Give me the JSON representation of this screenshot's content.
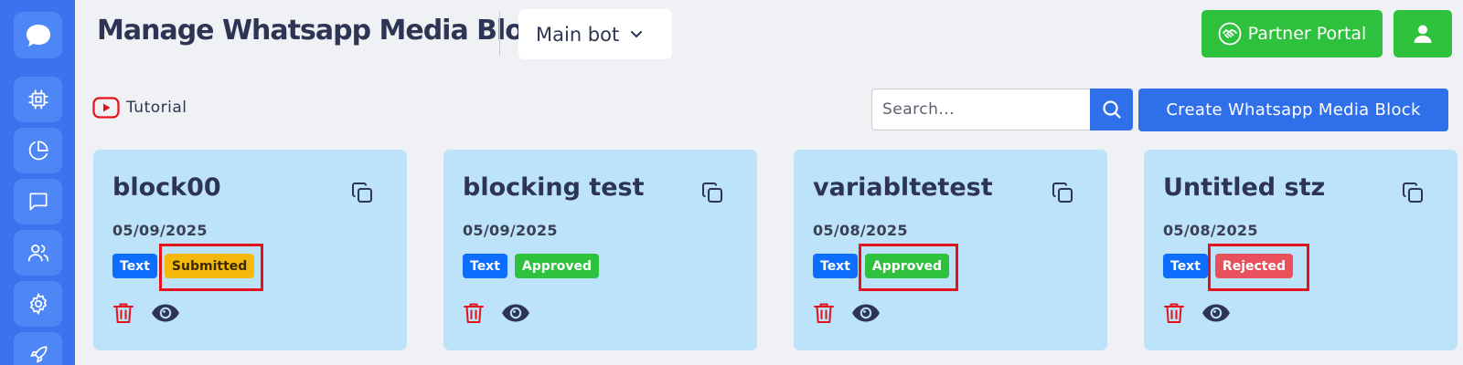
{
  "header": {
    "title": "Manage Whatsapp Media Blocks",
    "bot_select": {
      "value": "Main bot"
    },
    "partner_portal_label": "Partner Portal"
  },
  "sidebar": {
    "logo_icon": "chat-bubble-logo",
    "items": [
      {
        "icon": "chip-icon"
      },
      {
        "icon": "pie-chart-icon"
      },
      {
        "icon": "message-icon"
      },
      {
        "icon": "users-icon"
      },
      {
        "icon": "gear-icon"
      },
      {
        "icon": "rocket-icon"
      }
    ]
  },
  "toolbar": {
    "tutorial_label": "Tutorial",
    "search_placeholder": "Search...",
    "create_label": "Create Whatsapp Media Block"
  },
  "cards": [
    {
      "title": "block00",
      "date": "05/09/2025",
      "type": "Text",
      "status": "Submitted",
      "status_color": "#f5b80d",
      "status_text_color": "#3a2a00"
    },
    {
      "title": "blocking test",
      "date": "05/09/2025",
      "type": "Text",
      "status": "Approved",
      "status_color": "#2ec13e",
      "status_text_color": "#ffffff"
    },
    {
      "title": "variabltetest",
      "date": "05/08/2025",
      "type": "Text",
      "status": "Approved",
      "status_color": "#2ec13e",
      "status_text_color": "#ffffff"
    },
    {
      "title": "Untitled stz",
      "date": "05/08/2025",
      "type": "Text",
      "status": "Rejected",
      "status_color": "#e8505b",
      "status_text_color": "#ffffff"
    }
  ],
  "colors": {
    "sidebar": "#3a72f0",
    "primary": "#2f6fea",
    "success": "#2ec13e",
    "card_bg": "#bde3fb",
    "highlight": "#e3131b"
  }
}
